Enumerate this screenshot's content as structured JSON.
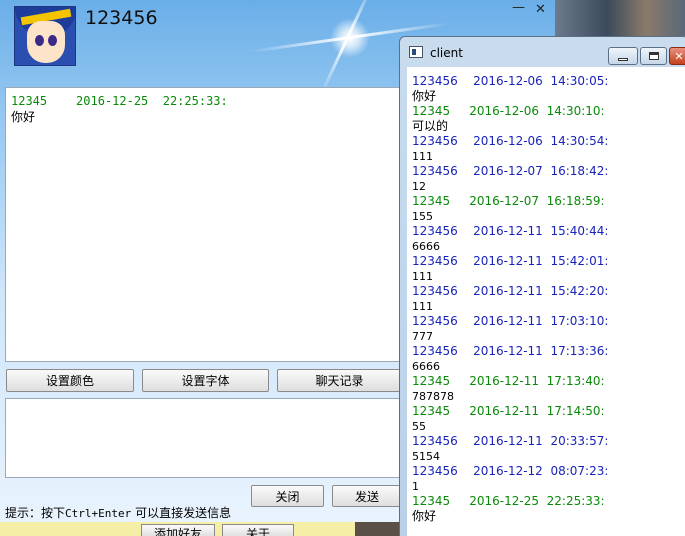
{
  "main_window": {
    "title": "123456",
    "minimize_glyph": "—",
    "close_glyph": "✕",
    "history": [
      {
        "sender": "12345",
        "date": "2016-12-25",
        "time": "22:25:33:",
        "text": "你好"
      }
    ],
    "toolbar": {
      "color_label": "设置颜色",
      "font_label": "设置字体",
      "history_label": "聊天记录"
    },
    "close_label": "关闭",
    "send_label": "发送",
    "tip_prefix": "提示：按下",
    "tip_keys": "Ctrl+Enter",
    "tip_suffix": " 可以直接发送信息",
    "add_friend_label": "添加好友",
    "about_label": "关于"
  },
  "client_window": {
    "title": "client",
    "close_glyph": "✕",
    "messages": [
      {
        "sender": "123456",
        "date": "2016-12-06",
        "time": "14:30:05:",
        "text": "你好",
        "color": "#1a23b8"
      },
      {
        "sender": "12345",
        "date": "2016-12-06",
        "time": "14:30:10:",
        "text": "可以的",
        "color": "#0a8a0a"
      },
      {
        "sender": "123456",
        "date": "2016-12-06",
        "time": "14:30:54:",
        "text": "111",
        "color": "#1a23b8"
      },
      {
        "sender": "123456",
        "date": "2016-12-07",
        "time": "16:18:42:",
        "text": "12",
        "color": "#1a23b8"
      },
      {
        "sender": "12345",
        "date": "2016-12-07",
        "time": "16:18:59:",
        "text": "155",
        "color": "#0a8a0a"
      },
      {
        "sender": "123456",
        "date": "2016-12-11",
        "time": "15:40:44:",
        "text": "6666",
        "color": "#1a23b8"
      },
      {
        "sender": "123456",
        "date": "2016-12-11",
        "time": "15:42:01:",
        "text": "111",
        "color": "#1a23b8"
      },
      {
        "sender": "123456",
        "date": "2016-12-11",
        "time": "15:42:20:",
        "text": "111",
        "color": "#1a23b8"
      },
      {
        "sender": "123456",
        "date": "2016-12-11",
        "time": "17:03:10:",
        "text": "777",
        "color": "#1a23b8"
      },
      {
        "sender": "123456",
        "date": "2016-12-11",
        "time": "17:13:36:",
        "text": "6666",
        "color": "#1a23b8"
      },
      {
        "sender": "12345",
        "date": "2016-12-11",
        "time": "17:13:40:",
        "text": "787878",
        "color": "#0a8a0a"
      },
      {
        "sender": "12345",
        "date": "2016-12-11",
        "time": "17:14:50:",
        "text": "55",
        "color": "#0a8a0a"
      },
      {
        "sender": "123456",
        "date": "2016-12-11",
        "time": "20:33:57:",
        "text": "5154",
        "color": "#1a23b8"
      },
      {
        "sender": "123456",
        "date": "2016-12-12",
        "time": "08:07:23:",
        "text": "1",
        "color": "#1a23b8"
      },
      {
        "sender": "12345",
        "date": "2016-12-25",
        "time": "22:25:33:",
        "text": "你好",
        "color": "#0a8a0a"
      }
    ]
  }
}
